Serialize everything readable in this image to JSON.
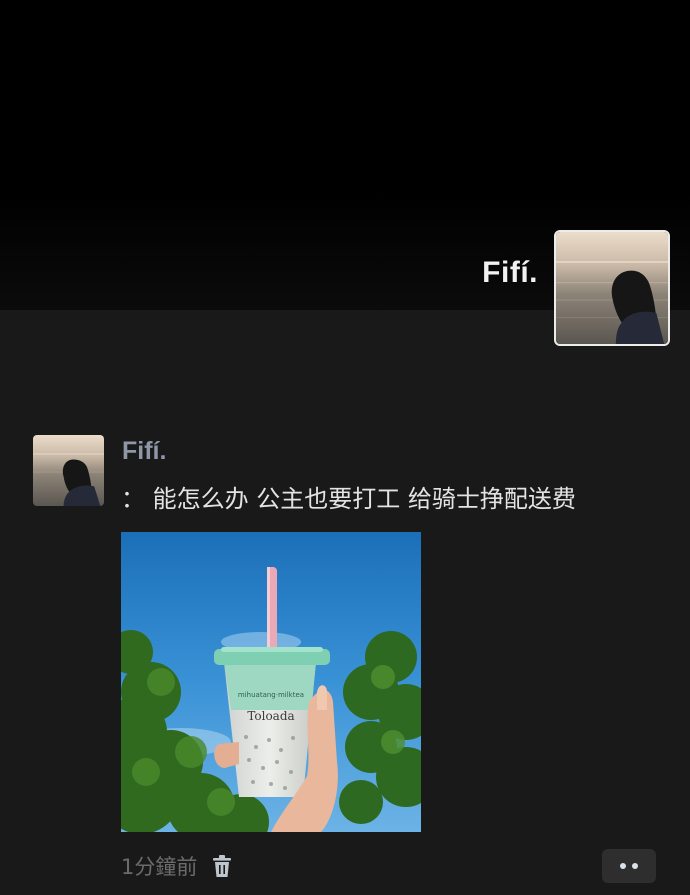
{
  "header": {
    "name": "Fifí.",
    "avatar_icon": "avatar-image"
  },
  "post": {
    "author": "Fifí.",
    "text": "： 能怎么办 公主也要打工 给骑士挣配送费",
    "photo": {
      "cup_text_brand": "Toloada",
      "cup_text_small": "mihuatang·milktea"
    },
    "timestamp": "1分鐘前",
    "delete_icon": "trash-icon",
    "more_icon": "more-dots-icon"
  },
  "colors": {
    "background": "#191919",
    "header_background": "#000000",
    "author_name": "#8f96a6",
    "body_text": "#e3e3e3",
    "timestamp": "#6b6b6b"
  }
}
